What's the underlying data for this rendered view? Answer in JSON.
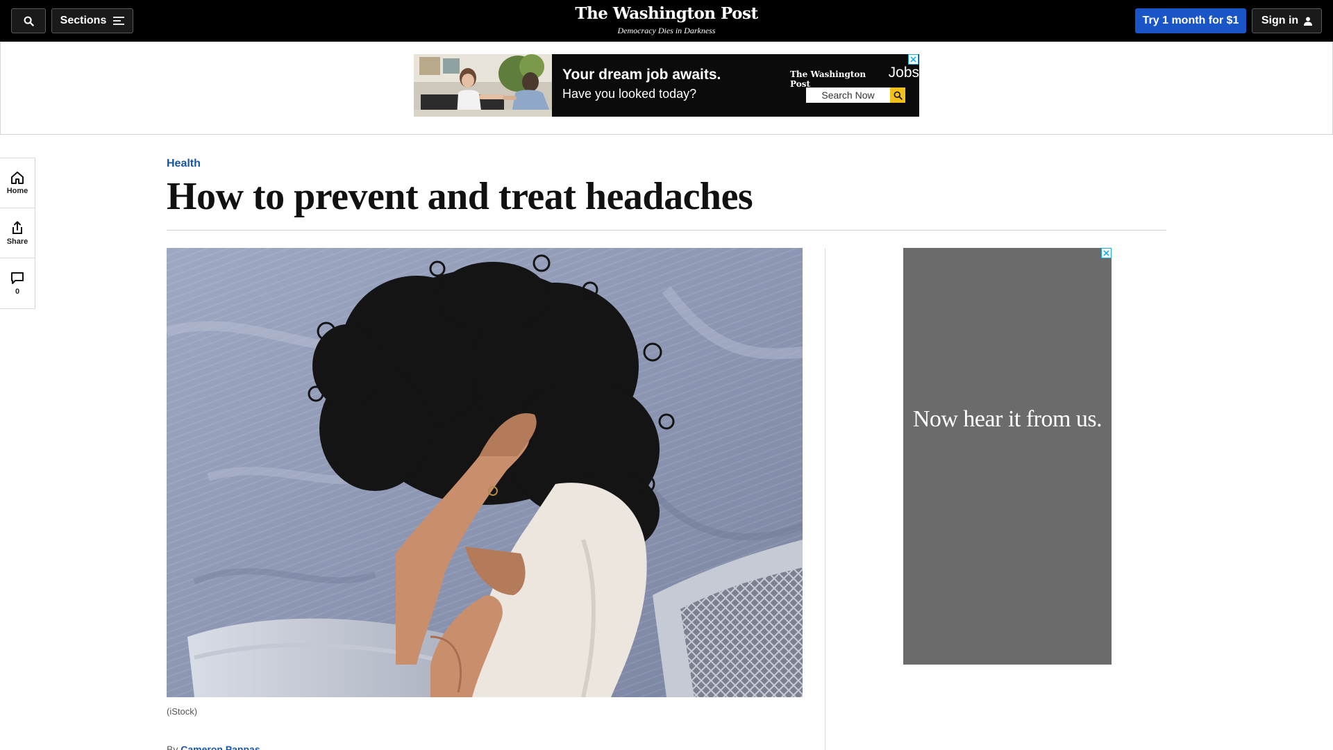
{
  "header": {
    "sections_label": "Sections",
    "logo_text": "The Washington Post",
    "tagline": "Democracy Dies in Darkness",
    "subscribe_label": "Try 1 month for $1",
    "signin_label": "Sign in"
  },
  "top_ad": {
    "headline": "Your dream job awaits.",
    "subline": "Have you looked today?",
    "brand_logo": "The Washington Post",
    "brand_product": "Jobs",
    "search_label": "Search Now"
  },
  "rail": {
    "home_label": "Home",
    "share_label": "Share",
    "comments_count": "0"
  },
  "article": {
    "kicker": "Health",
    "headline": "How to prevent and treat headaches",
    "caption": "(iStock)",
    "byline_prefix": "By",
    "byline_name": "Cameron Pappas"
  },
  "side_ad": {
    "text": "Now hear it from us."
  },
  "colors": {
    "topbar": "#000000",
    "subscribe": "#1955c7",
    "kicker": "#1955a5",
    "side_ad_bg": "#6b6b6b",
    "ad_choice": "#19b0e0"
  },
  "icons": [
    "search-icon",
    "menu-icon",
    "user-icon",
    "home-icon",
    "share-icon",
    "comment-icon",
    "close-icon"
  ]
}
